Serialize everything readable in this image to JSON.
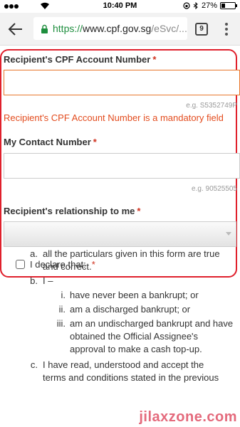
{
  "status_bar": {
    "time": "10:40 PM",
    "battery_text": "27%",
    "battery_level": 0.27
  },
  "browser": {
    "url_protocol": "https://",
    "url_domain": "www.cpf.gov.sg",
    "url_path": "/eSvc/...",
    "tab_count": "9"
  },
  "form": {
    "account_label": "Recipient's CPF Account Number",
    "account_value": "",
    "account_hint": "e.g. S5352749P",
    "account_error": "Recipient's CPF Account Number is a mandatory field",
    "contact_label": "My Contact Number",
    "contact_value": "",
    "contact_hint": "e.g. 90525505",
    "relationship_label": "Recipient's relationship to me",
    "relationship_value": "",
    "required_mark": "*",
    "declare_label": "I declare that:"
  },
  "declaration": {
    "a_marker": "a.",
    "a_text": "all the particulars given in this form are true and correct.",
    "b_marker": "b.",
    "b_text": "I –",
    "b_sub": [
      {
        "marker": "i.",
        "text": "have never been a bankrupt; or"
      },
      {
        "marker": "ii.",
        "text": "am a discharged bankrupt; or"
      },
      {
        "marker": "iii.",
        "text": "am an undischarged bankrupt and have obtained the Official Assignee's approval to make a cash top-up."
      }
    ],
    "c_marker": "c.",
    "c_text": "I have read, understood and accept the terms and conditions stated in the previous"
  },
  "watermark": "jilaxzone.com",
  "colors": {
    "required": "#d0311e",
    "error": "#e34b1d",
    "highlight_border": "#e0202c",
    "url_secure": "#1e8e3e"
  }
}
